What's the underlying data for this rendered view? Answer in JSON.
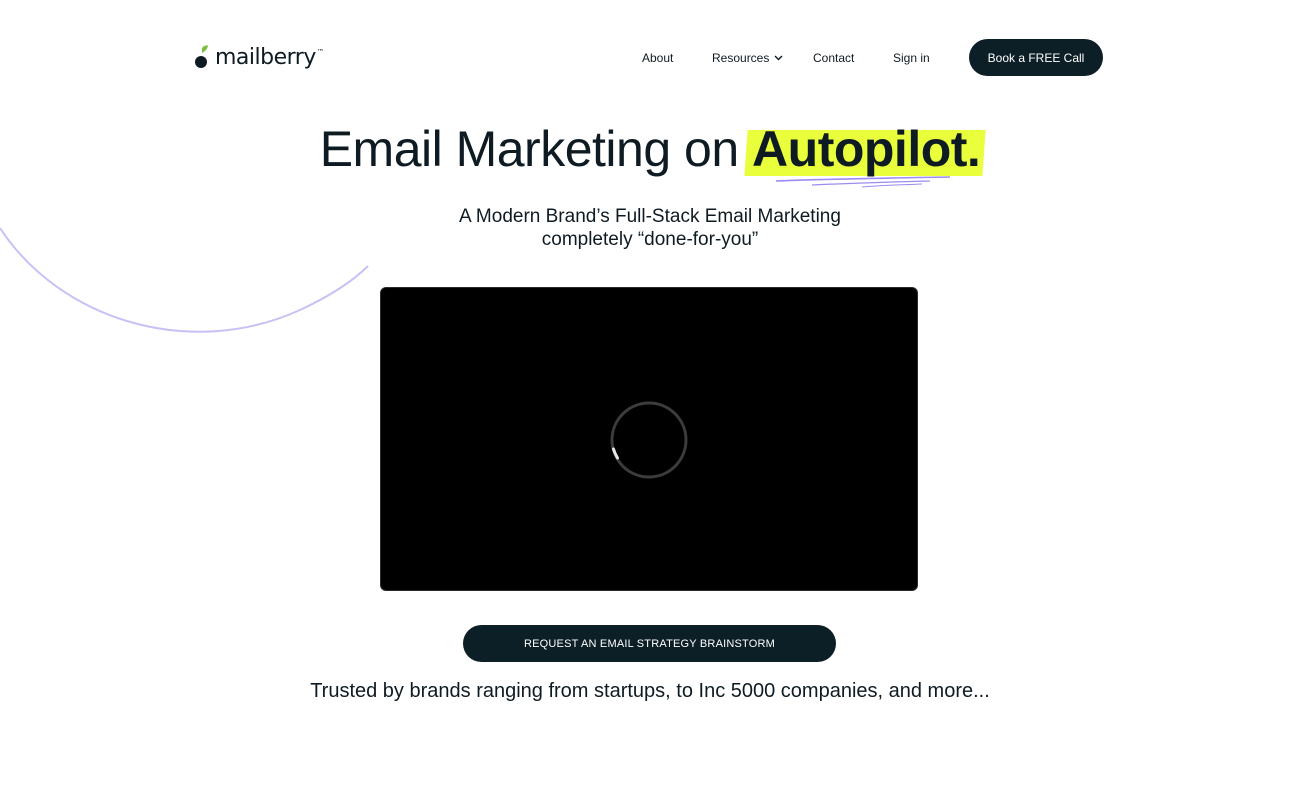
{
  "brand": {
    "name": "mailberry",
    "trademark": "™",
    "logo_icon": "berry-leaf-icon"
  },
  "nav": {
    "items": [
      {
        "label": "About"
      },
      {
        "label": "Resources",
        "icon": "chevron-down-icon"
      },
      {
        "label": "Contact"
      },
      {
        "label": "Sign in"
      }
    ],
    "cta_label": "Book a FREE Call"
  },
  "hero": {
    "title_prefix": "Email Marketing on ",
    "title_highlight": "Autopilot.",
    "subtitle_line1": "A Modern Brand’s Full-Stack Email Marketing",
    "subtitle_line2": "completely “done-for-you”",
    "video_state_icon": "loading-spinner-icon",
    "cta_label": "REQUEST AN EMAIL STRATEGY BRAINSTORM",
    "trusted_text": "Trusted by brands ranging from startups, to Inc 5000 companies, and more..."
  },
  "colors": {
    "accent_highlight": "#e9ff3b",
    "button_dark": "#0d1f26",
    "decor_lavender": "#c9c1f5",
    "scribble": "#9b8cf0"
  }
}
